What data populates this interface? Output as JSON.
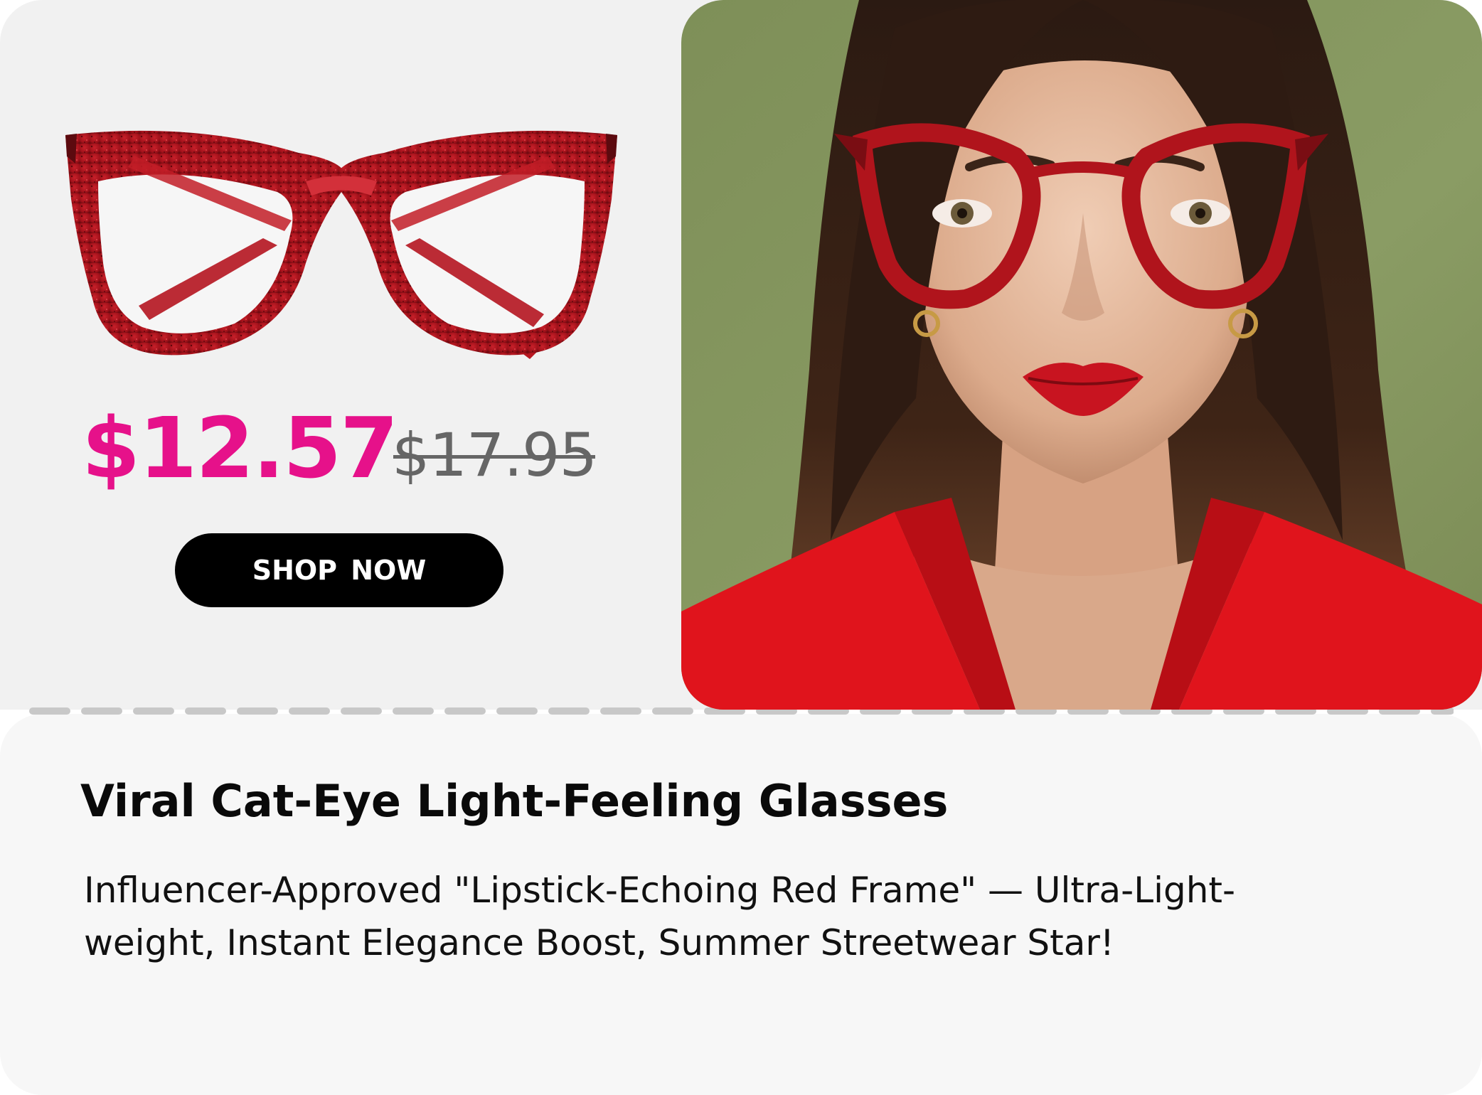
{
  "product": {
    "title": "Viral Cat-Eye Light-Feeling Glasses",
    "description": "Influencer-Approved \"Lipstick-Echoing Red Frame\" — Ultra-Light-weight, Instant Elegance Boost, Summer Streetwear Star!",
    "image_icon": "cat-eye-glasses-icon",
    "frame_color": "#b0141c"
  },
  "pricing": {
    "current_price": "$12.57",
    "original_price": "$17.95",
    "current_price_color": "#e6118a",
    "original_price_color": "#666666"
  },
  "cta": {
    "shop_label": "SHOP  NOW",
    "button_color": "#000000",
    "text_color": "#ffffff"
  },
  "hero": {
    "background_color": "#8a9a62",
    "accent_lips": "#c81420",
    "accent_blazer": "#e0141c"
  }
}
